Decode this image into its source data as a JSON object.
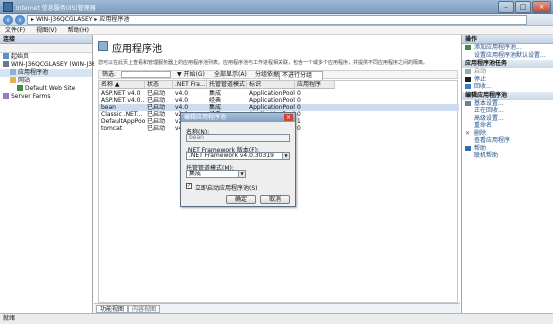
{
  "window": {
    "title": "Internet 信息服务(IIS)管理器"
  },
  "address": {
    "segments": [
      "WIN-J36QCGLASEY",
      "应用程序池"
    ],
    "separator": "▸"
  },
  "menu": {
    "items": [
      "文件(F)",
      "视图(V)",
      "帮助(H)"
    ]
  },
  "connections": {
    "title": "连接",
    "tree": [
      {
        "label": "起始页",
        "indent": 0,
        "icon": "start-page-icon"
      },
      {
        "label": "WIN-J36QCGLASEY (WIN-J36QC",
        "indent": 0,
        "icon": "server-icon"
      },
      {
        "label": "应用程序池",
        "indent": 1,
        "icon": "app-pool-icon",
        "selected": true
      },
      {
        "label": "网站",
        "indent": 1,
        "icon": "sites-icon"
      },
      {
        "label": "Default Web Site",
        "indent": 2,
        "icon": "website-icon"
      },
      {
        "label": "Server Farms",
        "indent": 0,
        "icon": "server-farm-icon"
      }
    ]
  },
  "main": {
    "title": "应用程序池",
    "description": "您可以在此页上查看和管理服务器上的应用程序池列表。应用程序池与工作进程相关联，包含一个或多个应用程序，并提供不同应用程序之间的隔离。",
    "filter": {
      "label": "筛选:",
      "start": "▼ 开始(G)",
      "show_all": "全部显示(A)",
      "group_by": "分组依据:",
      "group_value": "不进行分组"
    },
    "columns": [
      "名称 ▲",
      "状态",
      ".NET Fra...",
      "托管管道模式",
      "标识",
      "应用程序"
    ],
    "rows": [
      [
        "ASP.NET v4.0",
        "已启动",
        "v4.0",
        "集成",
        "ApplicationPool...",
        "0"
      ],
      [
        "ASP.NET v4.0...",
        "已启动",
        "v4.0",
        "经典",
        "ApplicationPool...",
        "0"
      ],
      [
        "bean",
        "已启动",
        "v4.0",
        "集成",
        "ApplicationPool...",
        "0"
      ],
      [
        "Classic .NET...",
        "已启动",
        "v2.0",
        "经典",
        "ApplicationPool...",
        "0"
      ],
      [
        "DefaultAppPool",
        "已启动",
        "v2.0",
        "集成",
        "ApplicationPool...",
        "1"
      ],
      [
        "tomcat",
        "已启动",
        "v4.0",
        "集成",
        "ApplicationPool...",
        "0"
      ]
    ],
    "selected_row": 2,
    "tabs": [
      "功能视图",
      "内容视图"
    ]
  },
  "dialog": {
    "title": "编辑应用程序池",
    "name_label": "名称(N):",
    "name_value": "bean",
    "framework_label": ".NET Framework 版本(F):",
    "framework_value": ".NET Framework v4.0.30319",
    "pipeline_label": "托管管道模式(M):",
    "pipeline_value": "集成",
    "autostart_label": "立即启动应用程序池(S)",
    "autostart_checked": true,
    "ok_label": "确定",
    "cancel_label": "取消"
  },
  "actions": {
    "title": "操作",
    "groups": [
      {
        "header": "",
        "items": [
          {
            "label": "添加应用程序池...",
            "icon": "add-icon"
          },
          {
            "label": "设置应用程序池默认设置...",
            "icon": ""
          }
        ]
      },
      {
        "header": "应用程序池任务",
        "items": [
          {
            "label": "启动",
            "icon": "play-icon",
            "disabled": true
          },
          {
            "label": "停止",
            "icon": "stop-icon"
          },
          {
            "label": "回收...",
            "icon": "recycle-icon"
          }
        ]
      },
      {
        "header": "编辑应用程序池",
        "items": [
          {
            "label": "基本设置...",
            "icon": "settings-icon"
          },
          {
            "label": "正在回收...",
            "icon": ""
          },
          {
            "label": "高级设置...",
            "icon": ""
          },
          {
            "label": "重命名",
            "icon": ""
          },
          {
            "label": "删除",
            "icon": "delete-icon"
          },
          {
            "label": "查看应用程序",
            "icon": ""
          }
        ]
      },
      {
        "header": "",
        "items": [
          {
            "label": "帮助",
            "icon": "help-icon"
          },
          {
            "label": "联机帮助",
            "icon": ""
          }
        ]
      }
    ]
  },
  "status": {
    "text": "就绪"
  },
  "colors": {
    "accent": "#1d4f8a",
    "titlebar": "#7c9cbd",
    "selection": "#cddcee"
  }
}
